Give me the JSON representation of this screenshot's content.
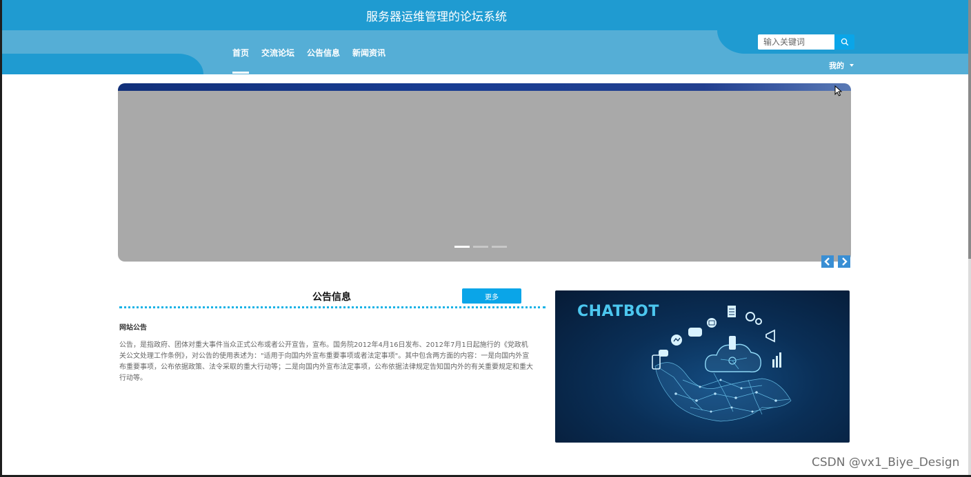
{
  "header": {
    "title": "服务器运维管理的论坛系统",
    "nav": [
      {
        "label": "首页",
        "active": true
      },
      {
        "label": "交流论坛",
        "active": false
      },
      {
        "label": "公告信息",
        "active": false
      },
      {
        "label": "新闻资讯",
        "active": false
      }
    ],
    "search": {
      "placeholder": "输入关键词",
      "value": ""
    },
    "user_menu_label": "我的"
  },
  "carousel": {
    "slide_count": 3,
    "active_index": 0
  },
  "notice": {
    "section_title": "公告信息",
    "more_label": "更多",
    "item_title": "网站公告",
    "item_body": "公告，是指政府、团体对重大事件当众正式公布或者公开宣告，宣布。国务院2012年4月16日发布、2012年7月1日起施行的《党政机关公文处理工作条例》，对公告的使用表述为：\"适用于向国内外宣布重要事项或者法定事项\"。其中包含两方面的内容：一是向国内外宣布重要事项，公布依据政策、法令采取的重大行动等；二是向国内外宣布法定事项，公布依据法律规定告知国内外的有关重要规定和重大行动等。"
  },
  "promo_image": {
    "text": "CHATBOT",
    "icons": [
      "messenger-icon",
      "sms-icon",
      "email-icon",
      "document-icon",
      "gears-icon",
      "megaphone-icon",
      "bar-chart-icon",
      "smartphone-icon",
      "cloud-icon",
      "robot-hand-icon"
    ]
  },
  "watermark": "CSDN @vx1_Biye_Design",
  "colors": {
    "header_dark": "#1f9bd1",
    "header_light": "#55aed6",
    "accent": "#0aa5e8",
    "dotted_line": "#15b2e6",
    "banner_placeholder": "#a9a9a9",
    "chatbot_text": "#4cc7ef"
  }
}
